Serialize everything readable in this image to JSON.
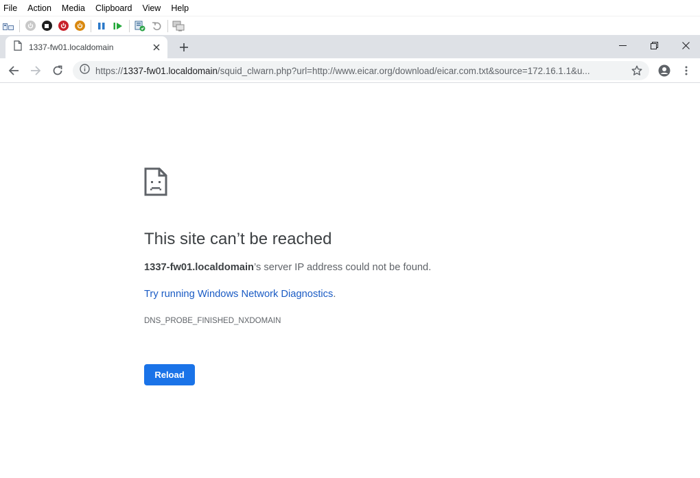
{
  "vm": {
    "menu": [
      "File",
      "Action",
      "Media",
      "Clipboard",
      "View",
      "Help"
    ],
    "toolbar_icons": [
      "ctrl-alt-del-icon",
      "start-icon",
      "turn-off-icon",
      "shut-down-icon",
      "power-icon",
      "pause-icon",
      "resume-icon",
      "checkpoint-icon",
      "revert-icon",
      "enhanced-session-icon"
    ]
  },
  "browser": {
    "tab": {
      "title": "1337-fw01.localdomain"
    },
    "address": {
      "scheme": "https://",
      "host": "1337-fw01.localdomain",
      "path": "/squid_clwarn.php?url=http://www.eicar.org/download/eicar.com.txt&source=172.16.1.1&u..."
    }
  },
  "error": {
    "title": "This site can’t be reached",
    "host": "1337-fw01.localdomain",
    "desc_suffix": "’s server IP address could not be found.",
    "link": "Try running Windows Network Diagnostics",
    "link_suffix": ".",
    "code": "DNS_PROBE_FINISHED_NXDOMAIN",
    "reload_label": "Reload"
  },
  "colors": {
    "accent": "#1a73e8",
    "link": "#1a5bc4",
    "tabstrip": "#dee1e6"
  }
}
